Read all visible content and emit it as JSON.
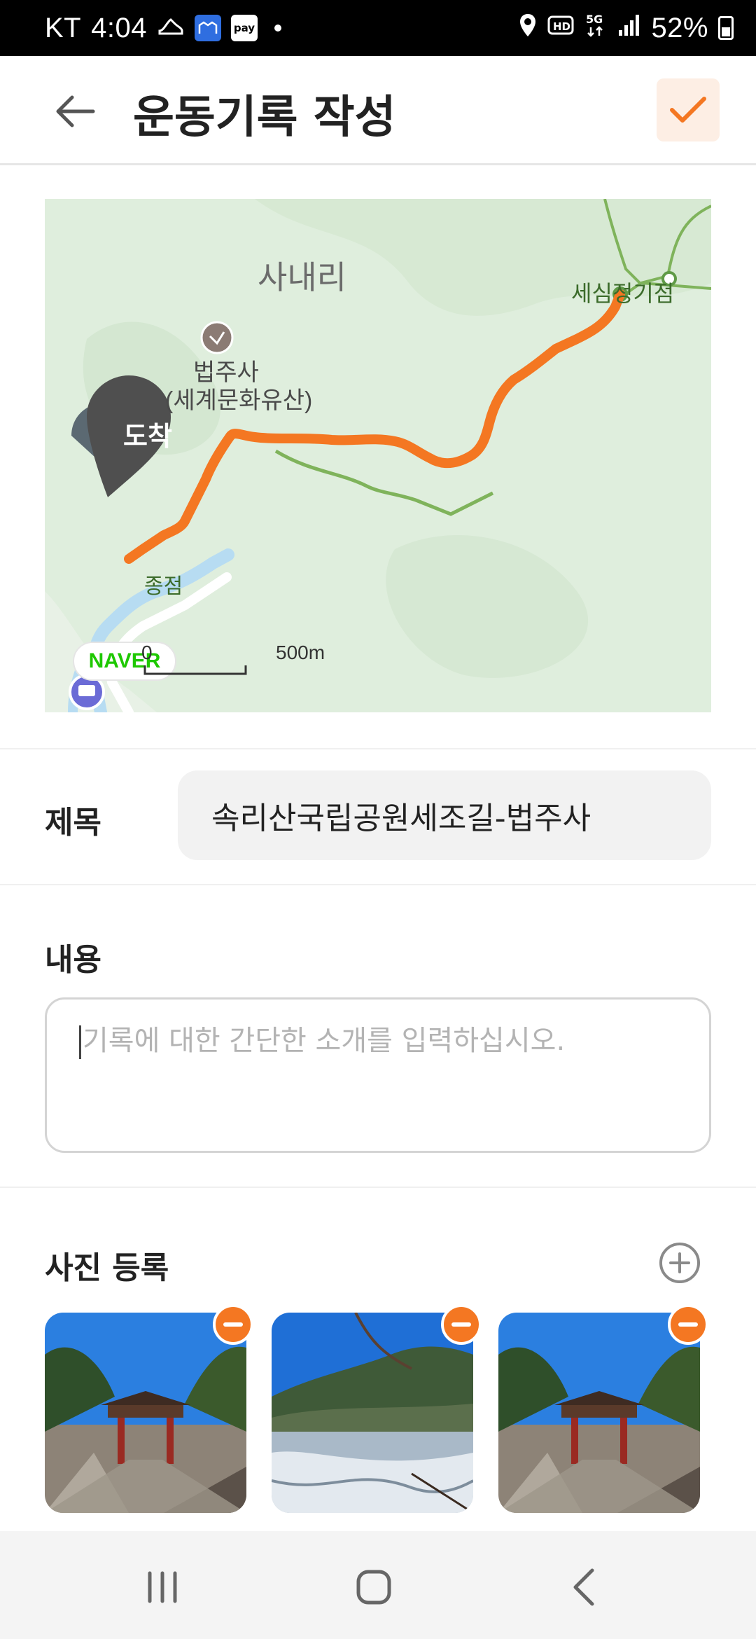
{
  "status_bar": {
    "carrier": "KT",
    "time": "4:04",
    "pay_label": "pay",
    "battery": "52%"
  },
  "header": {
    "title": "운동기록 작성"
  },
  "map": {
    "labels": {
      "village": "사내리",
      "temple_name": "법주사",
      "temple_sub": "(세계문화유산)",
      "checkpoint": "세심정기점",
      "stop": "종점",
      "arrival_marker": "도착"
    },
    "brand": "NAVER",
    "scale_start": "0",
    "scale_end": "500m",
    "colors": {
      "route": "#f47722",
      "trail": "#7fb35b",
      "land": "#dfeedd"
    }
  },
  "form": {
    "title_label": "제목",
    "title_value": "속리산국립공원세조길-법주사",
    "content_label": "내용",
    "content_placeholder": "기록에 대한 간단한 소개를 입력하십시오.",
    "photos_label": "사진 등록"
  },
  "photos": [
    {
      "subject": "temple-gate"
    },
    {
      "subject": "frozen-river"
    },
    {
      "subject": "temple-gate"
    }
  ],
  "nav": [
    "recent-apps",
    "home",
    "back"
  ],
  "accent": "#f47722"
}
